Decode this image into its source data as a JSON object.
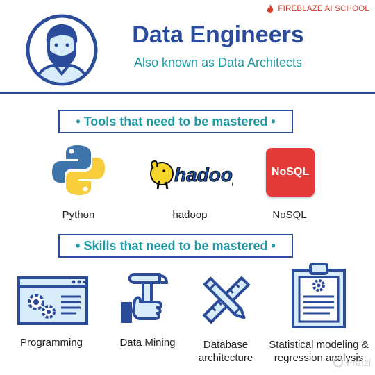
{
  "brand": {
    "name": "FIREBLAZE AI SCHOOL",
    "icon": "flame-icon",
    "color": "#d33b2c"
  },
  "header": {
    "title": "Data Engineers",
    "subtitle": "Also known as Data Architects",
    "avatar_icon": "bearded-person-icon"
  },
  "tools_section": {
    "heading": "• Tools that need to be mastered •",
    "items": [
      {
        "label": "Python",
        "icon": "python-logo-icon"
      },
      {
        "label": "hadoop",
        "icon": "hadoop-logo-icon",
        "logo_text": "hadoop"
      },
      {
        "label": "NoSQL",
        "icon": "nosql-logo-icon",
        "logo_text": "NoSQL"
      }
    ]
  },
  "skills_section": {
    "heading": "• Skills that need to be mastered •",
    "items": [
      {
        "label": "Programming",
        "icon": "browser-gears-icon"
      },
      {
        "label": "Data Mining",
        "icon": "hand-hammer-icon"
      },
      {
        "label_line1": "Database",
        "label_line2": "architecture",
        "icon": "ruler-pencil-icon"
      },
      {
        "label_line1": "Statistical modeling &",
        "label_line2": "regression analysis",
        "icon": "clipboard-gear-icon"
      }
    ]
  },
  "watermark": {
    "text": "Pratzi"
  },
  "colors": {
    "primary": "#2b4c9b",
    "accent": "#1f9aa6",
    "light_blue": "#d7ecf8"
  }
}
